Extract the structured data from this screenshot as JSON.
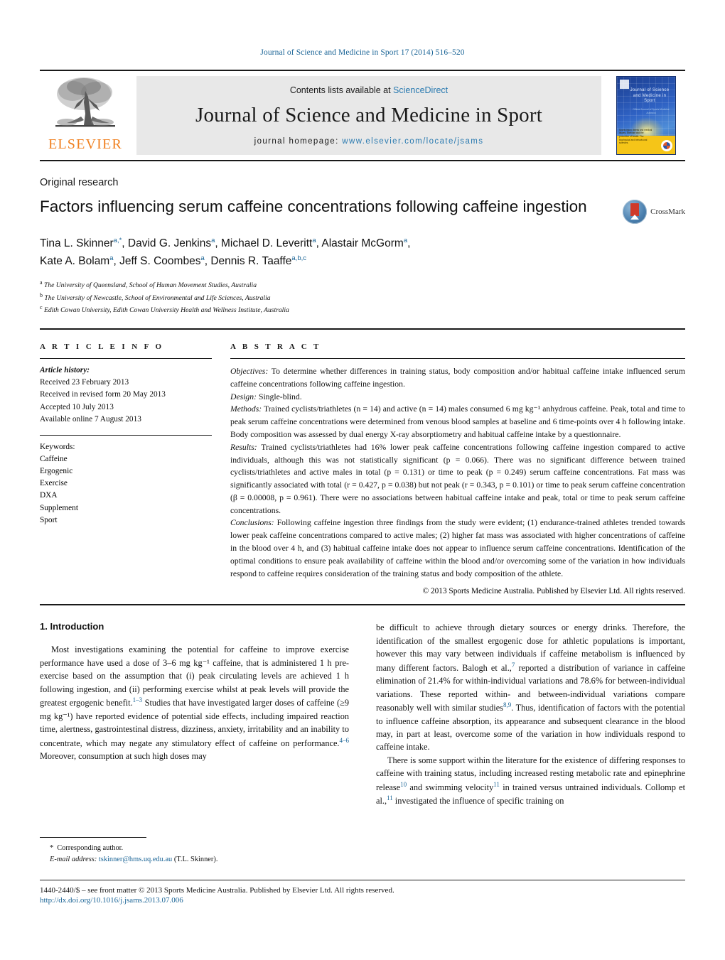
{
  "running_head": "Journal of Science and Medicine in Sport 17 (2014) 516–520",
  "masthead": {
    "publisher_name": "ELSEVIER",
    "contents_prefix": "Contents lists available at",
    "contents_link": "ScienceDirect",
    "journal_title": "Journal of Science and Medicine in Sport",
    "homepage_prefix": "journal homepage:",
    "homepage_url": "www.elsevier.com/locate/jsams",
    "cover": {
      "title": "Journal of Science and Medicine in Sport",
      "subtitle": "Official Journal of Sports Medicine Australia",
      "band_text": "Sports injury, illness and medical issues. Exercise and the promotion of health. The biophysical and behavioural sciences."
    }
  },
  "article": {
    "type_label": "Original research",
    "title": "Factors influencing serum caffeine concentrations following caffeine ingestion",
    "crossmark_label": "CrossMark",
    "authors_line_1": "Tina L. Skinner<sup>a,*</sup>, David G. Jenkins<sup>a</sup>, Michael D. Leveritt<sup>a</sup>, Alastair McGorm<sup>a</sup>,",
    "authors_line_2": "Kate A. Bolam<sup>a</sup>, Jeff S. Coombes<sup>a</sup>, Dennis R. Taaffe<sup>a,b,c</sup>",
    "affiliations": [
      {
        "marker": "a",
        "text": "The University of Queensland, School of Human Movement Studies, Australia"
      },
      {
        "marker": "b",
        "text": "The University of Newcastle, School of Environmental and Life Sciences, Australia"
      },
      {
        "marker": "c",
        "text": "Edith Cowan University, Edith Cowan University Health and Wellness Institute, Australia"
      }
    ]
  },
  "article_info": {
    "heading": "A R T I C L E    I N F O",
    "history_label": "Article history:",
    "history": [
      "Received 23 February 2013",
      "Received in revised form 20 May 2013",
      "Accepted 10 July 2013",
      "Available online 7 August 2013"
    ],
    "keywords_label": "Keywords:",
    "keywords": [
      "Caffeine",
      "Ergogenic",
      "Exercise",
      "DXA",
      "Supplement",
      "Sport"
    ]
  },
  "abstract": {
    "heading": "A B S T R A C T",
    "objectives_label": "Objectives:",
    "objectives": " To determine whether differences in training status, body composition and/or habitual caffeine intake influenced serum caffeine concentrations following caffeine ingestion.",
    "design_label": "Design:",
    "design": " Single-blind.",
    "methods_label": "Methods:",
    "methods": " Trained cyclists/triathletes (n = 14) and active (n = 14) males consumed 6 mg kg⁻¹ anhydrous caffeine. Peak, total and time to peak serum caffeine concentrations were determined from venous blood samples at baseline and 6 time-points over 4 h following intake. Body composition was assessed by dual energy X-ray absorptiometry and habitual caffeine intake by a questionnaire.",
    "results_label": "Results:",
    "results": " Trained cyclists/triathletes had 16% lower peak caffeine concentrations following caffeine ingestion compared to active individuals, although this was not statistically significant (p = 0.066). There was no significant difference between trained cyclists/triathletes and active males in total (p = 0.131) or time to peak (p = 0.249) serum caffeine concentrations. Fat mass was significantly associated with total (r = 0.427, p = 0.038) but not peak (r = 0.343, p = 0.101) or time to peak serum caffeine concentration (β = 0.00008, p = 0.961). There were no associations between habitual caffeine intake and peak, total or time to peak serum caffeine concentrations.",
    "conclusions_label": "Conclusions:",
    "conclusions": " Following caffeine ingestion three findings from the study were evident; (1) endurance-trained athletes trended towards lower peak caffeine concentrations compared to active males; (2) higher fat mass was associated with higher concentrations of caffeine in the blood over 4 h, and (3) habitual caffeine intake does not appear to influence serum caffeine concentrations. Identification of the optimal conditions to ensure peak availability of caffeine within the blood and/or overcoming some of the variation in how individuals respond to caffeine requires consideration of the training status and body composition of the athlete.",
    "copyright": "© 2013 Sports Medicine Australia. Published by Elsevier Ltd. All rights reserved."
  },
  "introduction": {
    "heading": "1. Introduction",
    "left_para_1": "Most investigations examining the potential for caffeine to improve exercise performance have used a dose of 3–6 mg kg⁻¹ caffeine, that is administered 1 h pre-exercise based on the assumption that (i) peak circulating levels are achieved 1 h following ingestion, and (ii) performing exercise whilst at peak levels will provide the greatest ergogenic benefit.",
    "left_ref_1": "1–3",
    "left_para_1b": " Studies that have investigated larger doses of caffeine (≥9 mg kg⁻¹) have reported evidence of potential side effects, including impaired reaction time, alertness, gastrointestinal distress, dizziness, anxiety, irritability and an inability to concentrate, which may negate any stimulatory effect of caffeine on performance.",
    "left_ref_2": "4–6",
    "left_para_1c": " Moreover, consumption at such high doses may",
    "right_para_1a": "be difficult to achieve through dietary sources or energy drinks. Therefore, the identification of the smallest ergogenic dose for athletic populations is important, however this may vary between individuals if caffeine metabolism is influenced by many different factors. Balogh et al.,",
    "right_ref_1": "7",
    "right_para_1b": " reported a distribution of variance in caffeine elimination of 21.4% for within-individual variations and 78.6% for between-individual variations. These reported within- and between-individual variations compare reasonably well with similar studies",
    "right_ref_2": "8,9",
    "right_para_1c": ". Thus, identification of factors with the potential to influence caffeine absorption, its appearance and subsequent clearance in the blood may, in part at least, overcome some of the variation in how individuals respond to caffeine intake.",
    "right_para_2a": "There is some support within the literature for the existence of differing responses to caffeine with training status, including increased resting metabolic rate and epinephrine release",
    "right_ref_3": "10",
    "right_para_2b": " and swimming velocity",
    "right_ref_4": "11",
    "right_para_2c": " in trained versus untrained individuals. Collomp et al.,",
    "right_ref_5": "11",
    "right_para_2d": " investigated the influence of specific training on"
  },
  "footnote": {
    "star": "*",
    "corresponding": "Corresponding author.",
    "email_label": "E-mail address:",
    "email": "tskinner@hms.uq.edu.au",
    "email_suffix": "(T.L. Skinner)."
  },
  "footer": {
    "line1": "1440-2440/$ – see front matter © 2013 Sports Medicine Australia. Published by Elsevier Ltd. All rights reserved.",
    "doi": "http://dx.doi.org/10.1016/j.jsams.2013.07.006"
  },
  "colors": {
    "link_blue": "#1a6496",
    "sd_blue": "#2a7ab0",
    "elsevier_orange": "#f08020",
    "crossmark_red": "#cf3a2a"
  }
}
